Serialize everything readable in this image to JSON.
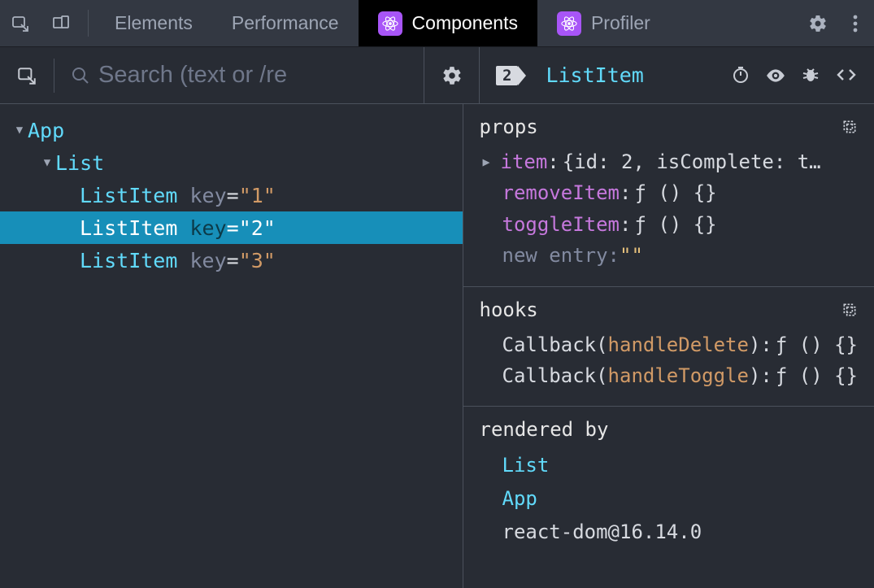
{
  "tabs": {
    "elements": "Elements",
    "performance": "Performance",
    "components": "Components",
    "profiler": "Profiler"
  },
  "search": {
    "placeholder": "Search (text or /re"
  },
  "selected": {
    "badge": "2",
    "name": "ListItem"
  },
  "tree": {
    "app": "App",
    "list": "List",
    "item1": {
      "name": "ListItem",
      "keylabel": "key",
      "keyval": "\"1\""
    },
    "item2": {
      "name": "ListItem",
      "keylabel": "key",
      "keyval": "\"2\""
    },
    "item3": {
      "name": "ListItem",
      "keylabel": "key",
      "keyval": "\"3\""
    }
  },
  "props": {
    "title": "props",
    "item": {
      "key": "item",
      "val": "{id: 2, isComplete: t…"
    },
    "removeItem": {
      "key": "removeItem",
      "val": "ƒ () {}"
    },
    "toggleItem": {
      "key": "toggleItem",
      "val": "ƒ () {}"
    },
    "newEntry": {
      "key": "new entry",
      "colon": ": ",
      "val": "\"\""
    }
  },
  "hooks": {
    "title": "hooks",
    "cb1": {
      "label": "Callback",
      "name": "handleDelete",
      "val": "ƒ () {}"
    },
    "cb2": {
      "label": "Callback",
      "name": "handleToggle",
      "val": "ƒ () {}"
    }
  },
  "renderedBy": {
    "title": "rendered by",
    "list": "List",
    "app": "App",
    "lib": "react-dom@16.14.0"
  }
}
